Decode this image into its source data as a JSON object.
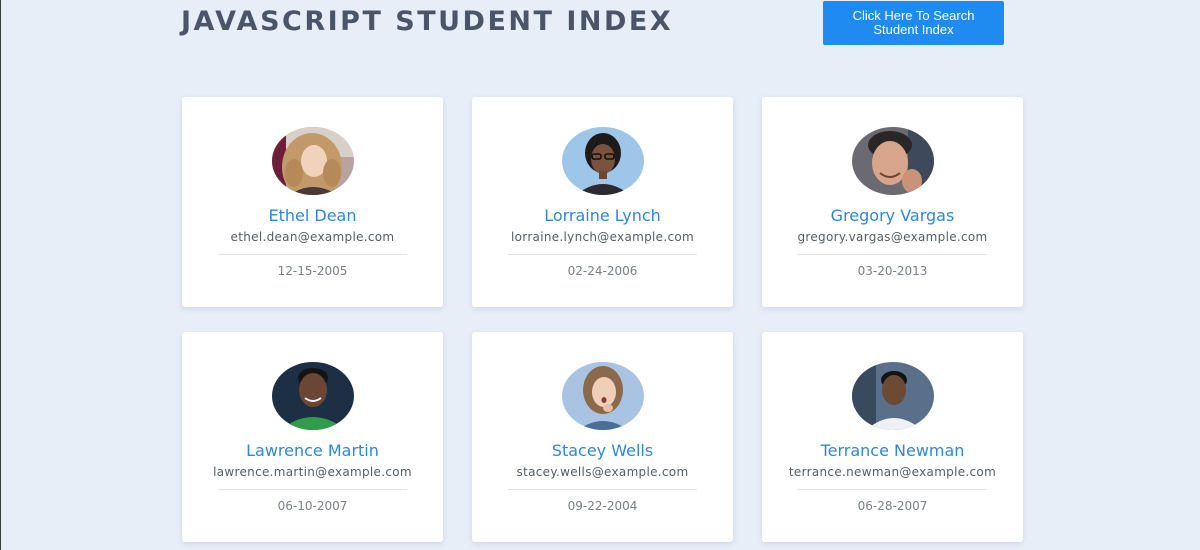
{
  "header": {
    "title": "JAVASCRIPT STUDENT INDEX",
    "search_button_label": "Click Here To Search Student Index"
  },
  "colors": {
    "background": "#e8eef8",
    "accent": "#1f8bf0",
    "name_color": "#2e86de",
    "title_color": "#4a5568"
  },
  "students": [
    {
      "name": "Ethel Dean",
      "email": "ethel.dean@example.com",
      "date": "12-15-2005",
      "avatar": "woman-curly-hair-photo"
    },
    {
      "name": "Lorraine Lynch",
      "email": "lorraine.lynch@example.com",
      "date": "02-24-2006",
      "avatar": "woman-glasses-photo"
    },
    {
      "name": "Gregory Vargas",
      "email": "gregory.vargas@example.com",
      "date": "03-20-2013",
      "avatar": "man-smiling-photo"
    },
    {
      "name": "Lawrence Martin",
      "email": "lawrence.martin@example.com",
      "date": "06-10-2007",
      "avatar": "man-green-shirt-photo"
    },
    {
      "name": "Stacey Wells",
      "email": "stacey.wells@example.com",
      "date": "09-22-2004",
      "avatar": "woman-surprised-photo"
    },
    {
      "name": "Terrance Newman",
      "email": "terrance.newman@example.com",
      "date": "06-28-2007",
      "avatar": "man-white-shirt-photo"
    }
  ]
}
